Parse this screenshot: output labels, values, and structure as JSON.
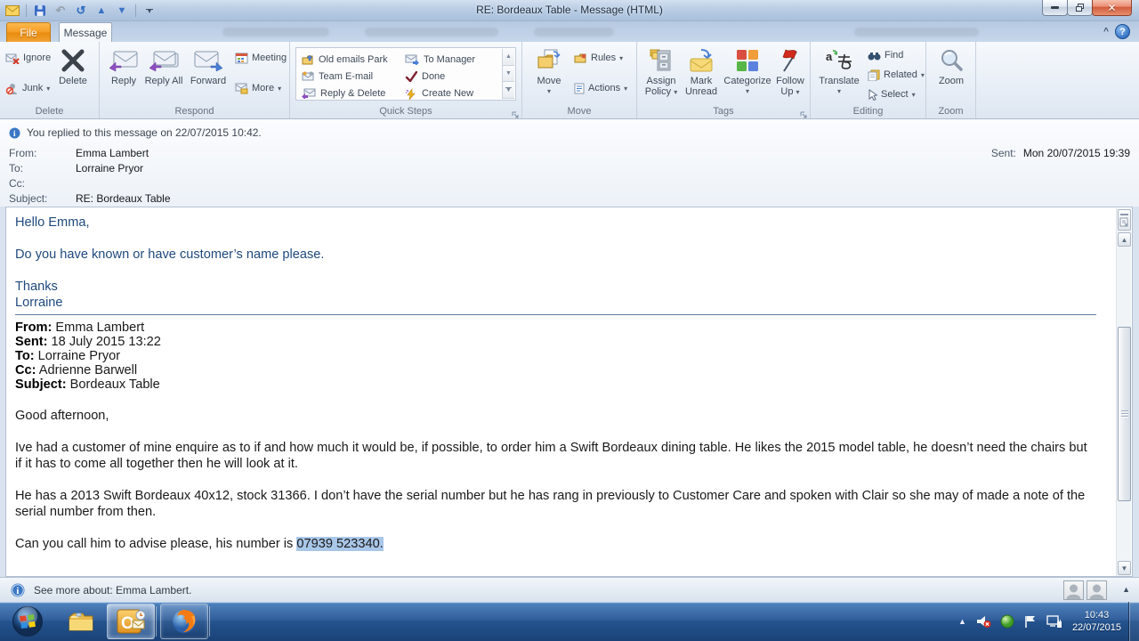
{
  "window": {
    "title": "RE: Bordeaux Table  -  Message (HTML)"
  },
  "tabs": {
    "file": "File",
    "message": "Message"
  },
  "ribbon": {
    "delete_group": {
      "label": "Delete",
      "ignore": "Ignore",
      "junk": "Junk",
      "delete": "Delete"
    },
    "respond_group": {
      "label": "Respond",
      "reply": "Reply",
      "reply_all": "Reply All",
      "forward": "Forward",
      "meeting": "Meeting",
      "more": "More"
    },
    "quick_steps_group": {
      "label": "Quick Steps",
      "items": [
        "Old emails Park",
        "Team E-mail",
        "Reply & Delete",
        "To Manager",
        "Done",
        "Create New"
      ]
    },
    "move_group": {
      "label": "Move",
      "move": "Move",
      "rules": "Rules",
      "actions": "Actions"
    },
    "tags_group": {
      "label": "Tags",
      "assign_policy": "Assign Policy",
      "mark_unread": "Mark Unread",
      "categorize": "Categorize",
      "follow_up": "Follow Up"
    },
    "editing_group": {
      "label": "Editing",
      "translate": "Translate",
      "find": "Find",
      "related": "Related",
      "select": "Select"
    },
    "zoom_group": {
      "label": "Zoom",
      "zoom": "Zoom"
    }
  },
  "infobar": {
    "text": "You replied to this message on 22/07/2015 10:42."
  },
  "header": {
    "from_label": "From:",
    "from_value": "Emma Lambert",
    "to_label": "To:",
    "to_value": "Lorraine Pryor",
    "cc_label": "Cc:",
    "cc_value": "",
    "subject_label": "Subject:",
    "subject_value": "RE: Bordeaux Table",
    "sent_label": "Sent:",
    "sent_value": "Mon 20/07/2015 19:39"
  },
  "message": {
    "greeting": "Hello Emma,",
    "question": "Do you have known or have customer’s name please.",
    "thanks": "Thanks",
    "signoff": "Lorraine",
    "quoted": {
      "from_label": "From:",
      "from": "Emma Lambert",
      "sent_label": "Sent:",
      "sent": "18 July 2015 13:22",
      "to_label": "To:",
      "to": "Lorraine Pryor",
      "cc_label": "Cc:",
      "cc": "Adrienne Barwell",
      "subject_label": "Subject:",
      "subject": "Bordeaux Table"
    },
    "salutation": "Good afternoon,",
    "para1": "Ive had a customer of mine enquire as to if and how much it would be, if possible, to order him a Swift Bordeaux dining table. He likes the 2015 model table, he doesn’t need the chairs but if it has to come all together then he will look at it.",
    "para2": "He has a 2013 Swift Bordeaux 40x12, stock 31366. I don’t have the serial number but he has rang in previously to Customer Care and spoken with Clair so she may of made a note of the serial number from then.",
    "para3_prefix": "Can you call him to advise please, his number is ",
    "para3_highlight": "07939 523340."
  },
  "people_pane": {
    "text": "See more about: Emma Lambert."
  },
  "taskbar": {
    "time": "10:43",
    "date": "22/07/2015"
  }
}
